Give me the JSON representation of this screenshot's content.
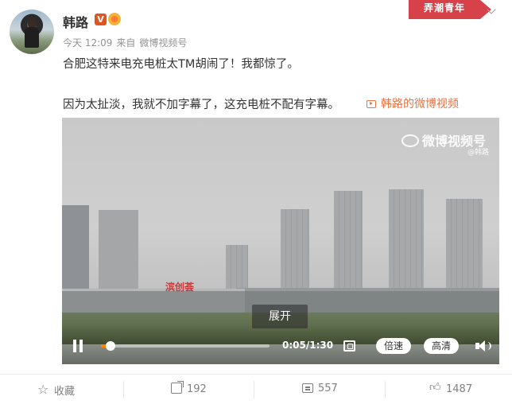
{
  "post": {
    "username": "韩路",
    "verified_label": "V",
    "time": "今天 12:09",
    "source_prefix": "来自",
    "source": "微博视频号",
    "text1": "合肥这特来电充电桩太TM胡闹了！我都惊了。",
    "text2": "因为太扯淡，我就不加字幕了，这充电桩不配有字幕。",
    "video_link": "韩路的微博视频"
  },
  "ribbon": {
    "label": "弄潮青年"
  },
  "video": {
    "watermark": "微博视频号",
    "watermark_author": "@韩路",
    "building_sign": "滨创荟",
    "expand_label": "展开",
    "time": "0:05/1:30",
    "progress": 0.056,
    "speed_label": "倍速",
    "quality_label": "高清"
  },
  "actions": {
    "favorite_label": "收藏",
    "share_count": "192",
    "comment_count": "557",
    "like_count": "1487"
  },
  "colors": {
    "accent": "#eb7340",
    "progress": "#ff8200",
    "ribbon": "#d6414a"
  }
}
